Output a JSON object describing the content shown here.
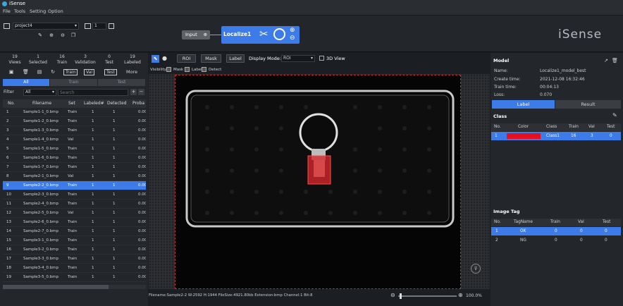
{
  "app": {
    "title": "iSense",
    "brand": "iSense"
  },
  "menu": [
    "File",
    "Tools",
    "Setting",
    "Option"
  ],
  "project": {
    "name": "project4",
    "page": "1"
  },
  "pipeline": {
    "input_label": "Input",
    "localize_label": "Localize1"
  },
  "stats": [
    {
      "value": "19",
      "label": "Views"
    },
    {
      "value": "1",
      "label": "Selected"
    },
    {
      "value": "16",
      "label": "Train"
    },
    {
      "value": "3",
      "label": "Validation"
    },
    {
      "value": "0",
      "label": "Test"
    },
    {
      "value": "19",
      "label": "Labeled"
    }
  ],
  "toolbar_left": {
    "train": "Train",
    "val": "Val",
    "test": "Test",
    "more": "More"
  },
  "set_tabs": [
    "All",
    "Train",
    "Test"
  ],
  "filter": {
    "label": "Filter",
    "value": "All",
    "search_placeholder": "Search"
  },
  "table": {
    "headers": [
      "No.",
      "Filename",
      "Set",
      "Labeled#",
      "Detected",
      "Proba"
    ],
    "rows": [
      [
        "1",
        "Sample1-1_0.bmp",
        "Train",
        "1",
        "1",
        "0.00"
      ],
      [
        "2",
        "Sample1-2_0.bmp",
        "Train",
        "1",
        "1",
        "0.00"
      ],
      [
        "3",
        "Sample1-3_0.bmp",
        "Train",
        "1",
        "1",
        "0.00"
      ],
      [
        "4",
        "Sample1-4_0.bmp",
        "Val",
        "1",
        "1",
        "0.00"
      ],
      [
        "5",
        "Sample1-5_0.bmp",
        "Train",
        "1",
        "1",
        "0.00"
      ],
      [
        "6",
        "Sample1-6_0.bmp",
        "Train",
        "1",
        "1",
        "0.00"
      ],
      [
        "7",
        "Sample1-7_0.bmp",
        "Train",
        "1",
        "1",
        "0.00"
      ],
      [
        "8",
        "Sample2-1_0.bmp",
        "Val",
        "1",
        "1",
        "0.00"
      ],
      [
        "9",
        "Sample2-2_0.bmp",
        "Train",
        "1",
        "1",
        "0.00"
      ],
      [
        "10",
        "Sample2-3_0.bmp",
        "Train",
        "1",
        "1",
        "0.00"
      ],
      [
        "11",
        "Sample2-4_0.bmp",
        "Train",
        "1",
        "1",
        "0.00"
      ],
      [
        "12",
        "Sample2-5_0.bmp",
        "Val",
        "1",
        "1",
        "0.00"
      ],
      [
        "13",
        "Sample2-6_0.bmp",
        "Train",
        "1",
        "1",
        "0.00"
      ],
      [
        "14",
        "Sample2-7_0.bmp",
        "Train",
        "1",
        "1",
        "0.00"
      ],
      [
        "15",
        "Sample3-1_0.bmp",
        "Train",
        "1",
        "1",
        "0.00"
      ],
      [
        "16",
        "Sample3-2_0.bmp",
        "Train",
        "1",
        "1",
        "0.00"
      ],
      [
        "17",
        "Sample3-3_0.bmp",
        "Train",
        "1",
        "1",
        "0.00"
      ],
      [
        "18",
        "Sample3-4_0.bmp",
        "Train",
        "1",
        "1",
        "0.00"
      ],
      [
        "19",
        "Sample3-5_0.bmp",
        "Train",
        "1",
        "1",
        "0.00"
      ]
    ],
    "selected_index": 8
  },
  "viewer": {
    "roi": "ROI",
    "mask": "Mask",
    "label": "Label",
    "display_mode_label": "Display Mode:",
    "display_mode_value": "ROI",
    "view3d": "3D View",
    "visibility": "Visibility",
    "vis_mask": "Mask",
    "vis_label": "Label",
    "vis_detect": "Detect",
    "status": "Filename:Sample2-2 W:2592 H:1944 FileSize:4921.80kb Extension:bmp Channel:1 Bit:8",
    "zoom": "100.0%"
  },
  "model": {
    "title": "Model",
    "fields": [
      {
        "k": "Name:",
        "v": "Localize1_model_best"
      },
      {
        "k": "Create time:",
        "v": "2021-12-08 16:32:46"
      },
      {
        "k": "Train time:",
        "v": "00:04:13"
      },
      {
        "k": "Loss:",
        "v": "0.070"
      }
    ],
    "tab_label": "Label",
    "tab_result": "Result"
  },
  "class": {
    "title": "Class",
    "headers": [
      "No.",
      "Color",
      "Class",
      "Train",
      "Val",
      "Test"
    ],
    "rows": [
      [
        "1",
        "",
        "Class1",
        "16",
        "3",
        "0"
      ]
    ],
    "color": "#e8101e"
  },
  "image_tag": {
    "title": "Image Tag",
    "headers": [
      "No.",
      "TagName",
      "Train",
      "Val",
      "Test"
    ],
    "rows": [
      [
        "1",
        "OK",
        "0",
        "0",
        "0"
      ],
      [
        "2",
        "NG",
        "0",
        "0",
        "0"
      ]
    ]
  }
}
